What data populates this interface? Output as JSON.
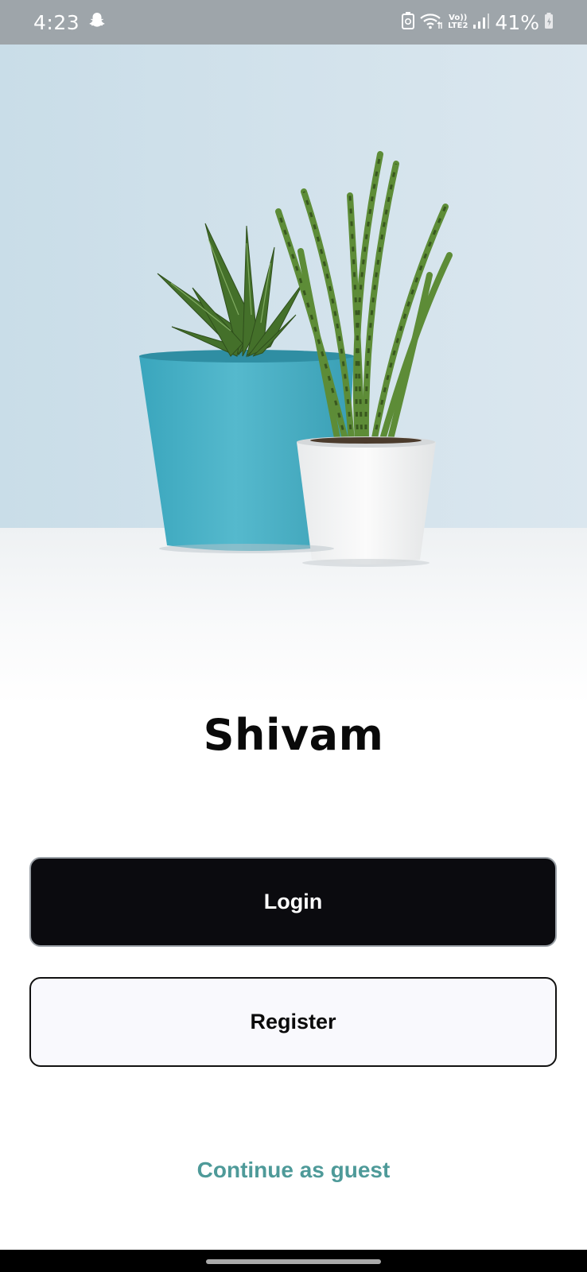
{
  "status_bar": {
    "time": "4:23",
    "network_top": "Vo))",
    "network_bottom": "LTE2",
    "battery": "41%",
    "icons": [
      "snapchat-icon",
      "battery-saver-icon",
      "wifi-icon",
      "signal-icon",
      "battery-charging-icon"
    ]
  },
  "hero": {
    "icon": "potted-plants-illustration",
    "colors": {
      "wall": "#cfe0ea",
      "pot_teal": "#49b2c7",
      "pot_white": "#f6f6f6",
      "plant_green": "#4f7f2f"
    }
  },
  "app": {
    "title": "Shivam"
  },
  "actions": {
    "login_label": "Login",
    "register_label": "Register",
    "guest_label": "Continue as guest"
  },
  "colors": {
    "guest_link": "#4e9a99",
    "login_bg": "#0b0b0f",
    "register_bg": "#f9f9fd"
  }
}
